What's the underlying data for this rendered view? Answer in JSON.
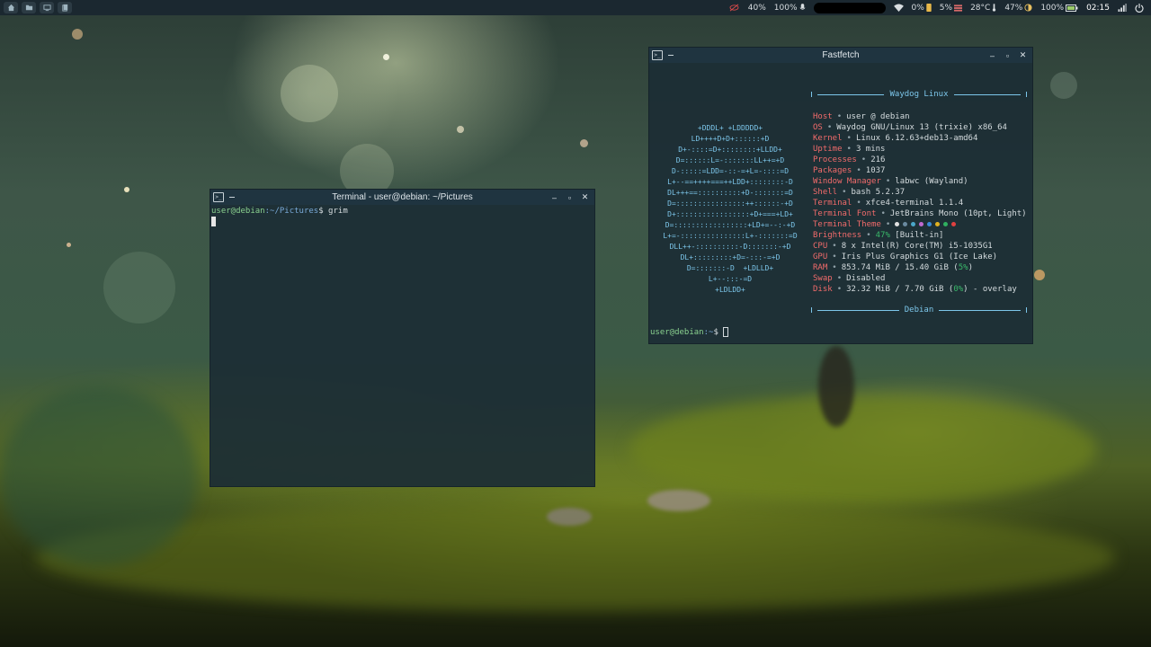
{
  "panel": {
    "launchers": [
      {
        "icon": "home-icon"
      },
      {
        "icon": "folder-icon"
      },
      {
        "icon": "monitor-icon"
      },
      {
        "icon": "files-icon"
      }
    ],
    "status": {
      "cpu": "40%",
      "volume": "100%",
      "network_usage": "0%",
      "memory": "5%",
      "temperature": "28°C",
      "brightness": "47%",
      "battery": "100%",
      "clock": "02:15"
    }
  },
  "terminal": {
    "title": "Terminal - user@debian: ~/Pictures",
    "prompt_user": "user@debian",
    "prompt_path": ":~/Pictures",
    "prompt_symbol": "$",
    "command": " grim"
  },
  "fastfetch": {
    "title": "Fastfetch",
    "header": "Waydog Linux",
    "footer": "Debian",
    "logo": [
      "+DDDL+ +LDDDDD+",
      "LD++++D+D+::::::+D",
      "D+-::::=D+::::::::+LLDD+",
      "D=::::::L=-:::::::LL++=+D",
      "D-:::::=LDD=-::-=+L=-::::=D",
      "L+--==++++===++LDD+::::::::-D",
      "DL+++==::::::::::+D-:::::::=D",
      "D=::::::::::::::::++::::::-+D",
      "D+:::::::::::::::::+D+===+LD+",
      "D=:::::::::::::::::+LD+=--:-+D",
      "L+=-:::::::::::::::L+-:::::::=D",
      "DLL++-::::::::::-D:::::::-+D",
      "DL+:::::::::+D=-:::-=+D",
      "D=:::::::-D  +LDLLD+",
      "L+--:::-=D",
      "+LDLDD+"
    ],
    "rows": [
      {
        "key": "Host",
        "value": "user @ debian"
      },
      {
        "key": "OS",
        "value": "Waydog GNU/Linux 13 (trixie) x86_64"
      },
      {
        "key": "Kernel",
        "value": "Linux 6.12.63+deb13-amd64"
      },
      {
        "key": "Uptime",
        "value": "3 mins"
      },
      {
        "key": "Processes",
        "value": "216"
      },
      {
        "key": "Packages",
        "value": "1037"
      },
      {
        "key": "Window Manager",
        "value": "labwc (Wayland)"
      },
      {
        "key": "Shell",
        "value": "bash 5.2.37"
      },
      {
        "key": "Terminal",
        "value": "xfce4-terminal 1.1.4"
      },
      {
        "key": "Terminal Font",
        "value": "JetBrains Mono (10pt, Light)"
      },
      {
        "key": "Terminal Theme",
        "value": ""
      },
      {
        "key": "Brightness",
        "value_pct": "47%",
        "value_rest": " [Built-in]"
      },
      {
        "key": "CPU",
        "value": "8 x Intel(R) Core(TM) i5-1035G1"
      },
      {
        "key": "GPU",
        "value": "Iris Plus Graphics G1 (Ice Lake)"
      },
      {
        "key": "RAM",
        "value": "853.74 MiB / 15.40 GiB (",
        "value_pct": "5%",
        "value_rest": ")"
      },
      {
        "key": "Swap",
        "value": "Disabled"
      },
      {
        "key": "Disk",
        "value": "32.32 MiB / 7.70 GiB (",
        "value_pct": "0%",
        "value_rest": ") - overlay"
      }
    ],
    "separator": "•",
    "theme_colors": [
      "#e0e0e0",
      "#6a8aa0",
      "#4aa6c8",
      "#c06ad0",
      "#3a8ad8",
      "#e0b020",
      "#30b060",
      "#e04040"
    ],
    "pct_color": "#39b86a",
    "prompt_user": "user@debian",
    "prompt_path": ":~",
    "prompt_symbol": "$"
  }
}
